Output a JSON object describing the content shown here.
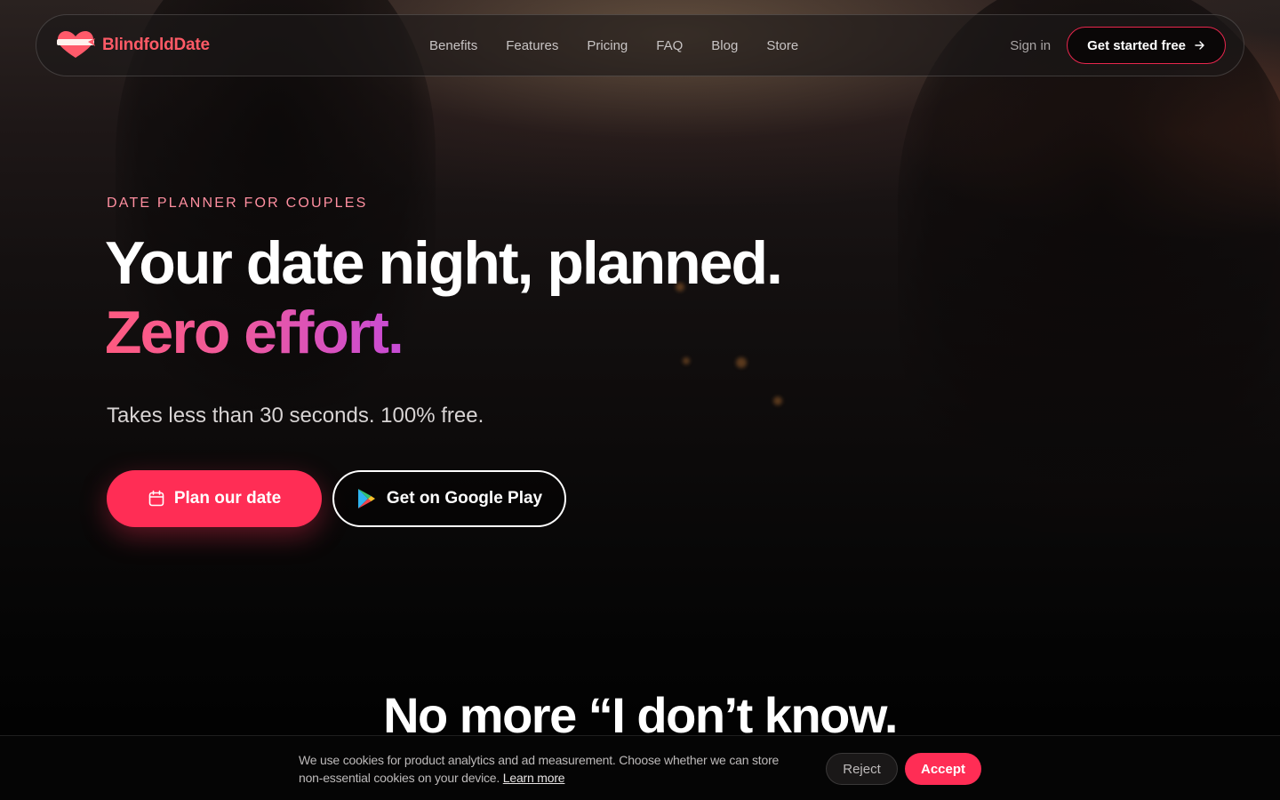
{
  "brand": {
    "name": "BlindfoldDate",
    "color": "#ff5a66",
    "icon": "heart-blindfold-icon"
  },
  "nav": {
    "links": [
      "Benefits",
      "Features",
      "Pricing",
      "FAQ",
      "Blog",
      "Store"
    ],
    "signin": "Sign in",
    "cta": "Get started free",
    "cta_icon": "arrow-right-icon"
  },
  "hero": {
    "eyebrow": "DATE PLANNER FOR COUPLES",
    "title": "Your date night, planned.",
    "title_accent": "Zero effort.",
    "subtitle": "Takes less than 30 seconds. 100% free.",
    "primary_button": "Plan our date",
    "primary_icon": "calendar-icon",
    "secondary_button": "Get on Google Play",
    "secondary_icon": "google-play-icon"
  },
  "next_section": {
    "title": "No more “I don’t know."
  },
  "cookie": {
    "text": "We use cookies for product analytics and ad measurement. Choose whether we can store non-essential cookies on your device.",
    "link": "Learn more",
    "reject": "Reject",
    "accept": "Accept"
  },
  "colors": {
    "accent": "#ff2d55",
    "eyebrow": "#ff8fa0",
    "gradient_start": "#ff5a80",
    "gradient_end": "#c74bd6"
  }
}
